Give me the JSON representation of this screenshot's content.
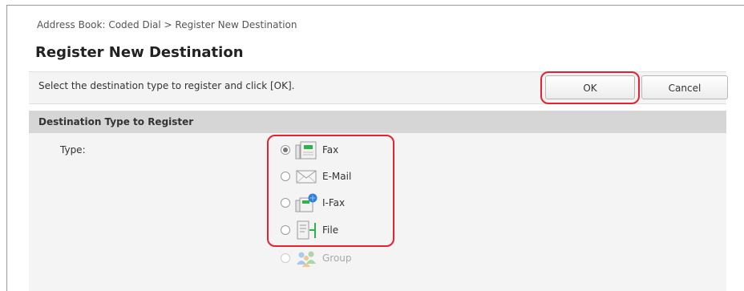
{
  "breadcrumb": "Address Book: Coded Dial > Register New Destination",
  "page_title": "Register New Destination",
  "instruction": "Select the destination type to register and click [OK].",
  "buttons": {
    "ok": "OK",
    "cancel": "Cancel"
  },
  "section": {
    "title": "Destination Type to Register",
    "type_label": "Type:"
  },
  "options": [
    {
      "label": "Fax",
      "icon": "fax-icon",
      "selected": true,
      "enabled": true
    },
    {
      "label": "E-Mail",
      "icon": "email-icon",
      "selected": false,
      "enabled": true
    },
    {
      "label": "I-Fax",
      "icon": "ifax-icon",
      "selected": false,
      "enabled": true
    },
    {
      "label": "File",
      "icon": "file-icon",
      "selected": false,
      "enabled": true
    },
    {
      "label": "Group",
      "icon": "group-icon",
      "selected": false,
      "enabled": false
    }
  ],
  "colors": {
    "highlight": "#e8212f",
    "section_header": "#d6d6d6",
    "panel": "#f4f4f4",
    "icon_green": "#2db34a",
    "icon_blue": "#2f7ed8"
  }
}
